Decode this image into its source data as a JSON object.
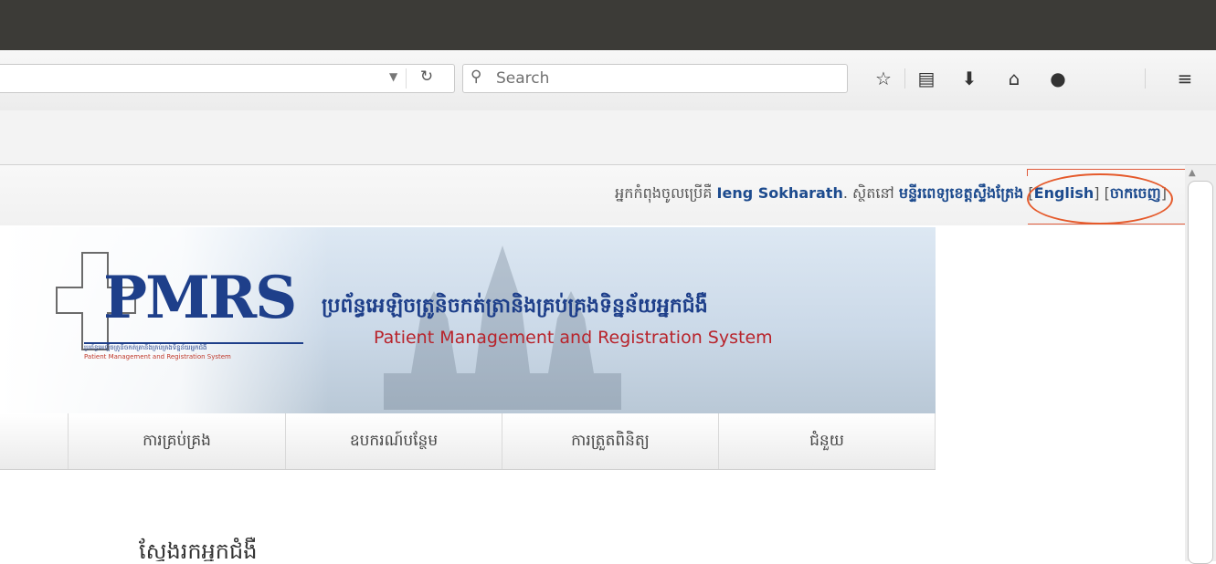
{
  "browser": {
    "search_placeholder": "Search",
    "icons": [
      "bookmark-star-icon",
      "reading-list-icon",
      "download-icon",
      "home-icon",
      "chat-icon",
      "menu-icon"
    ]
  },
  "userbar": {
    "logged_in_prefix": "អ្នកកំពុងចូលប្រើគឺ",
    "user_name": "Ieng Sokharath",
    "location_prefix": ". ស្ថិតនៅ",
    "facility": "មន្ទីរពេទ្យខេត្តស្ទឹងត្រែង",
    "english_link": "English",
    "logout_link": "ចាកចេញ"
  },
  "banner": {
    "logo_text": "PMRS",
    "logo_sub_km": "ប្រព័ន្ធអេឡិចត្រូនិចកត់ត្រានិងគ្រប់គ្រងទិន្នន័យអ្នកជំងឺ",
    "logo_sub_en": "Patient Management and Registration System",
    "system_name_km": "ប្រព័ន្ធអេឡិចត្រូនិចកត់ត្រានិងគ្រប់គ្រងទិន្នន័យអ្នកជំងឺ",
    "system_name_en": "Patient Management and Registration System"
  },
  "menu": {
    "items": [
      {
        "label": "ការគ្រប់គ្រង"
      },
      {
        "label": "ឧបករណ៍បន្ថែម"
      },
      {
        "label": "ការត្រួតពិនិត្យ"
      },
      {
        "label": "ជំនួយ"
      }
    ]
  },
  "page": {
    "heading": "ស្វែងរកអ្នកជំងឺ"
  },
  "colors": {
    "brand_blue": "#1e3f8a",
    "brand_red": "#b8232b",
    "highlight_ring": "#e55a2b"
  }
}
